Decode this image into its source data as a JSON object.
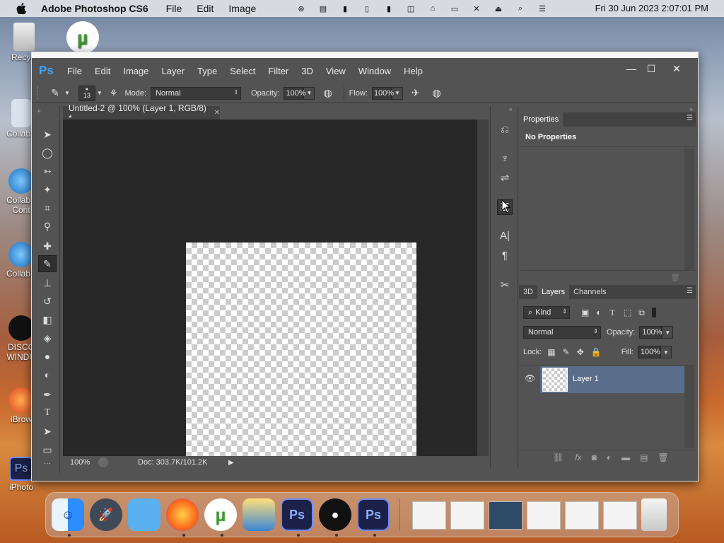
{
  "menubar": {
    "app_name": "Adobe Photoshop CS6",
    "items": [
      "File",
      "Edit",
      "Image"
    ],
    "clock": "Fri 30 Jun 2023  2:07:01 PM"
  },
  "desktop_icons": [
    "Recycl",
    "CollabS",
    "CollabS Cont",
    "CollabS",
    "DISCO WINDO",
    "iBrow",
    "iPhoto"
  ],
  "ps": {
    "logo": "Ps",
    "menu": [
      "File",
      "Edit",
      "Image",
      "Layer",
      "Type",
      "Select",
      "Filter",
      "3D",
      "View",
      "Window",
      "Help"
    ],
    "options": {
      "brush_size": "13",
      "mode_label": "Mode:",
      "mode_value": "Normal",
      "opacity_label": "Opacity:",
      "opacity_value": "100%",
      "flow_label": "Flow:",
      "flow_value": "100%"
    },
    "document_tab": "Untitled-2 @ 100% (Layer 1, RGB/8) *",
    "status": {
      "zoom": "100%",
      "doc": "Doc: 303.7K/101.2K"
    },
    "properties": {
      "title": "Properties",
      "content": "No Properties"
    },
    "layers_panel": {
      "tabs": [
        "3D",
        "Layers",
        "Channels"
      ],
      "kind_label": "Kind",
      "blend_mode": "Normal",
      "opacity_label": "Opacity:",
      "opacity_value": "100%",
      "lock_label": "Lock:",
      "fill_label": "Fill:",
      "fill_value": "100%",
      "layer_name": "Layer 1"
    }
  },
  "colors": {
    "ps_panel": "#535353",
    "ps_canvas_bg": "#282828",
    "ps_accent": "#3ea6ff",
    "layer_selected": "#5a6e8c"
  }
}
